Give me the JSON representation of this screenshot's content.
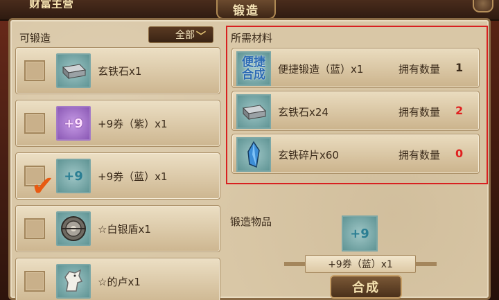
{
  "header": {
    "left_title": "财富主营",
    "title": "锻造"
  },
  "left_panel": {
    "label": "可锻造",
    "filter": {
      "selected": "全部"
    },
    "items": [
      {
        "name": "玄铁石x1",
        "icon": "iron-ingot-icon",
        "checked": false
      },
      {
        "name": "+9券（紫）x1",
        "icon": "plus9-ticket-purple-icon",
        "icon_text": "+9",
        "checked": false
      },
      {
        "name": "+9券（蓝）x1",
        "icon": "plus9-ticket-blue-icon",
        "icon_text": "+9",
        "checked": true
      },
      {
        "name": "☆白银盾x1",
        "icon": "silver-shield-icon",
        "checked": false
      },
      {
        "name": "☆的卢x1",
        "icon": "white-horse-icon",
        "checked": false
      }
    ]
  },
  "materials": {
    "label": "所需材料",
    "own_label": "拥有数量",
    "rows": [
      {
        "name": "便捷锻造（蓝）x1",
        "icon": "quick-forge-icon",
        "icon_text": "便捷合成",
        "owned": "1",
        "owned_color": "#3a2a1a"
      },
      {
        "name": "玄铁石x24",
        "icon": "iron-ingot-icon",
        "owned": "2",
        "owned_color": "#e02020"
      },
      {
        "name": "玄铁碎片x60",
        "icon": "iron-shard-icon",
        "owned": "0",
        "owned_color": "#e02020"
      }
    ]
  },
  "result": {
    "label": "锻造物品",
    "icon_text": "+9",
    "name": "+9券（蓝）x1",
    "button": "合成"
  }
}
